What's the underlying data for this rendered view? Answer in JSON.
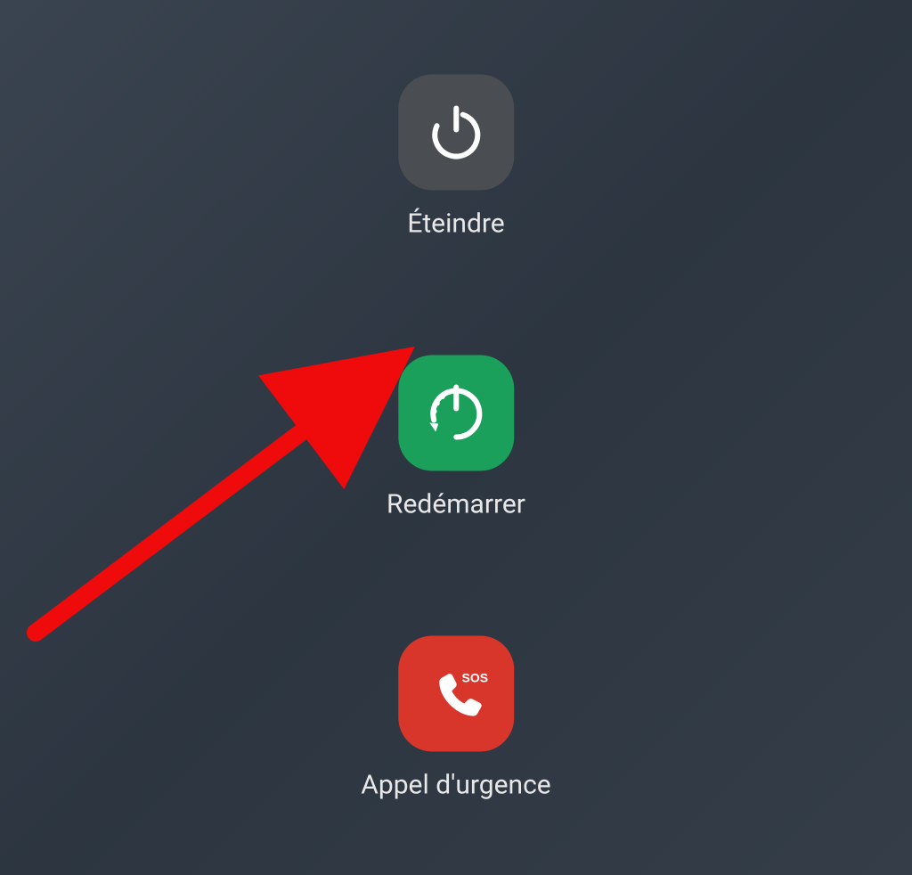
{
  "menu": {
    "power_off": {
      "label": "Éteindre",
      "icon_name": "power-icon",
      "color": "#4a4e52"
    },
    "restart": {
      "label": "Redémarrer",
      "icon_name": "restart-icon",
      "color": "#1aa05a"
    },
    "emergency": {
      "label": "Appel d'urgence",
      "icon_name": "phone-sos-icon",
      "sos_text": "SOS",
      "color": "#d9362b"
    }
  },
  "annotation": {
    "type": "arrow",
    "target": "restart-button",
    "color": "#ef0b0b"
  }
}
